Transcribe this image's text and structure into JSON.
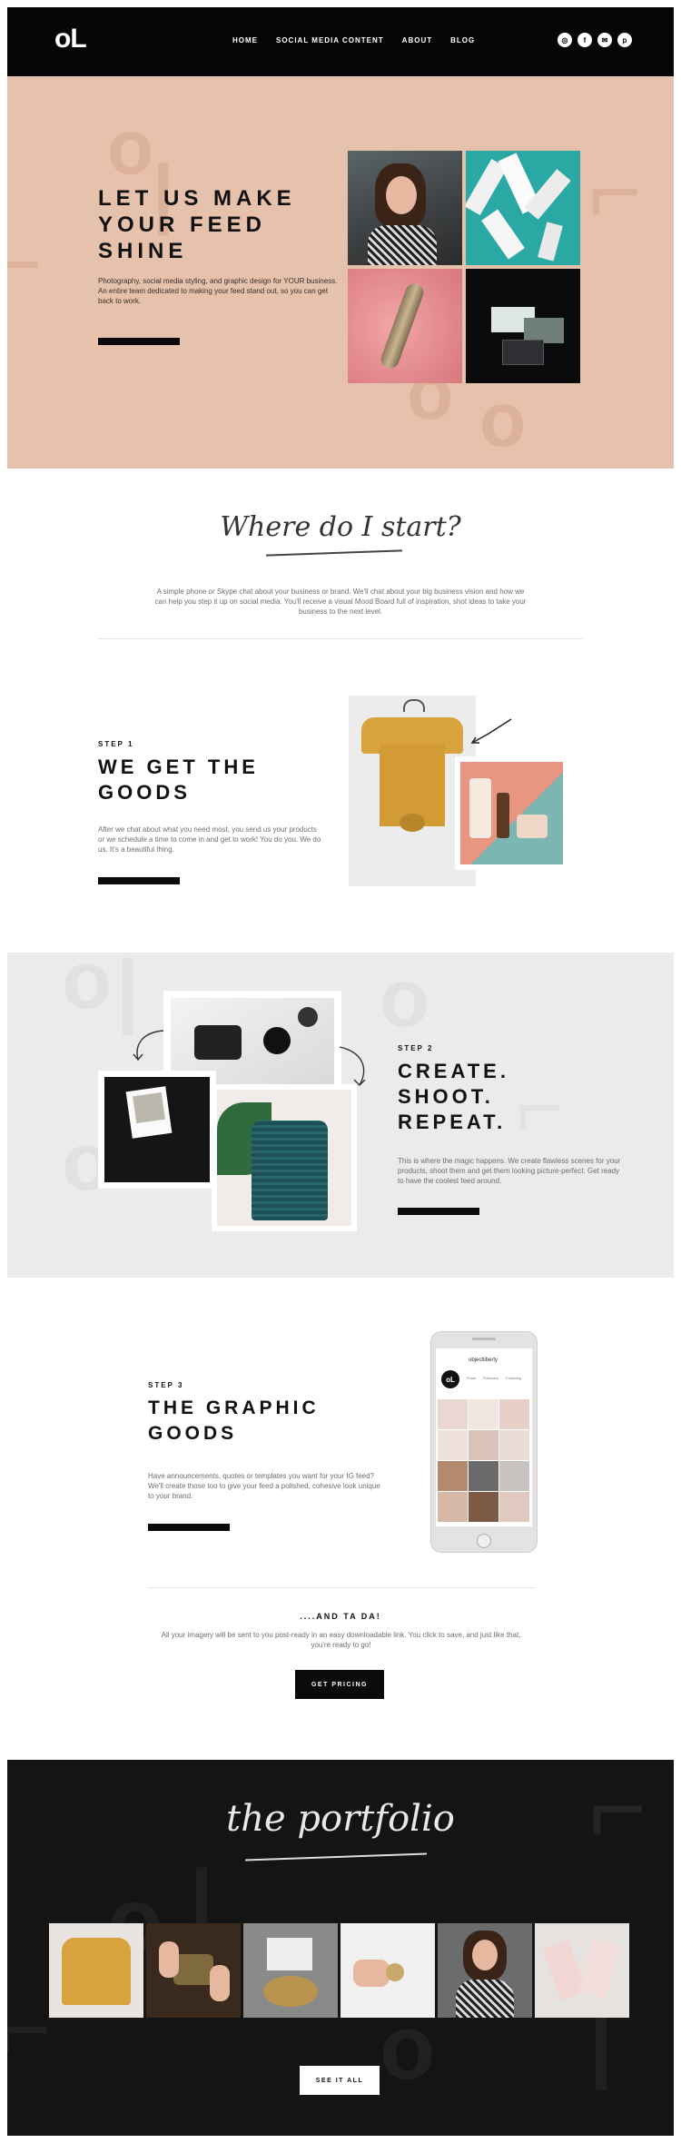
{
  "header": {
    "logo": "oL",
    "nav": [
      "HOME",
      "SOCIAL MEDIA CONTENT",
      "ABOUT",
      "BLOG"
    ],
    "social_icons": [
      "instagram-icon",
      "facebook-icon",
      "email-icon",
      "pinterest-icon"
    ],
    "social_glyphs": [
      "◎",
      "f",
      "✉",
      "p"
    ]
  },
  "hero": {
    "title": "LET US MAKE YOUR FEED SHINE",
    "text": "Photography, social media styling, and graphic design for YOUR business. An entire team dedicated to making your feed stand out, so you can get back to work."
  },
  "intro": {
    "script_title": "Where do I start?",
    "text": "A simple phone or Skype chat about your business or brand. We'll chat about your big business vision and how we can help you step it up on social media. You'll receive a visual Mood Board full of inspiration, shot ideas to take your business to the next level."
  },
  "step1": {
    "label": "STEP 1",
    "title": "WE GET THE GOODS",
    "text": "After we chat about what you need most, you send us your products or we schedule a time to come in and get to work! You do you. We do us. It's a beautiful thing."
  },
  "step2": {
    "label": "STEP 2",
    "title": "CREATE. SHOOT. REPEAT.",
    "text": "This is where the magic happens. We create flawless scenes for your products, shoot them and get them looking picture-perfect. Get ready to have the coolest feed around."
  },
  "step3": {
    "label": "STEP 3",
    "title": "THE GRAPHIC GOODS",
    "text": "Have announcements, quotes or templates you want for your IG feed? We'll create those too to give your feed a polished, cohesive look unique to your brand."
  },
  "phone": {
    "handle": "objectliberty",
    "stats": [
      "Posts",
      "Followers",
      "Following"
    ]
  },
  "tada": {
    "title": "....AND TA DA!",
    "text": "All your imagery will be sent to you post-ready in an easy downloadable link. You click to save, and just like that, you're ready to go!",
    "button": "GET PRICING"
  },
  "portfolio": {
    "script_title": "the portfolio",
    "button": "SEE IT ALL"
  },
  "colors": {
    "hero_bg": "#e6c2ad",
    "accent_teal": "#2aa8a4",
    "portfolio_bg": "#141414",
    "step2_bg": "#ebebeb"
  }
}
